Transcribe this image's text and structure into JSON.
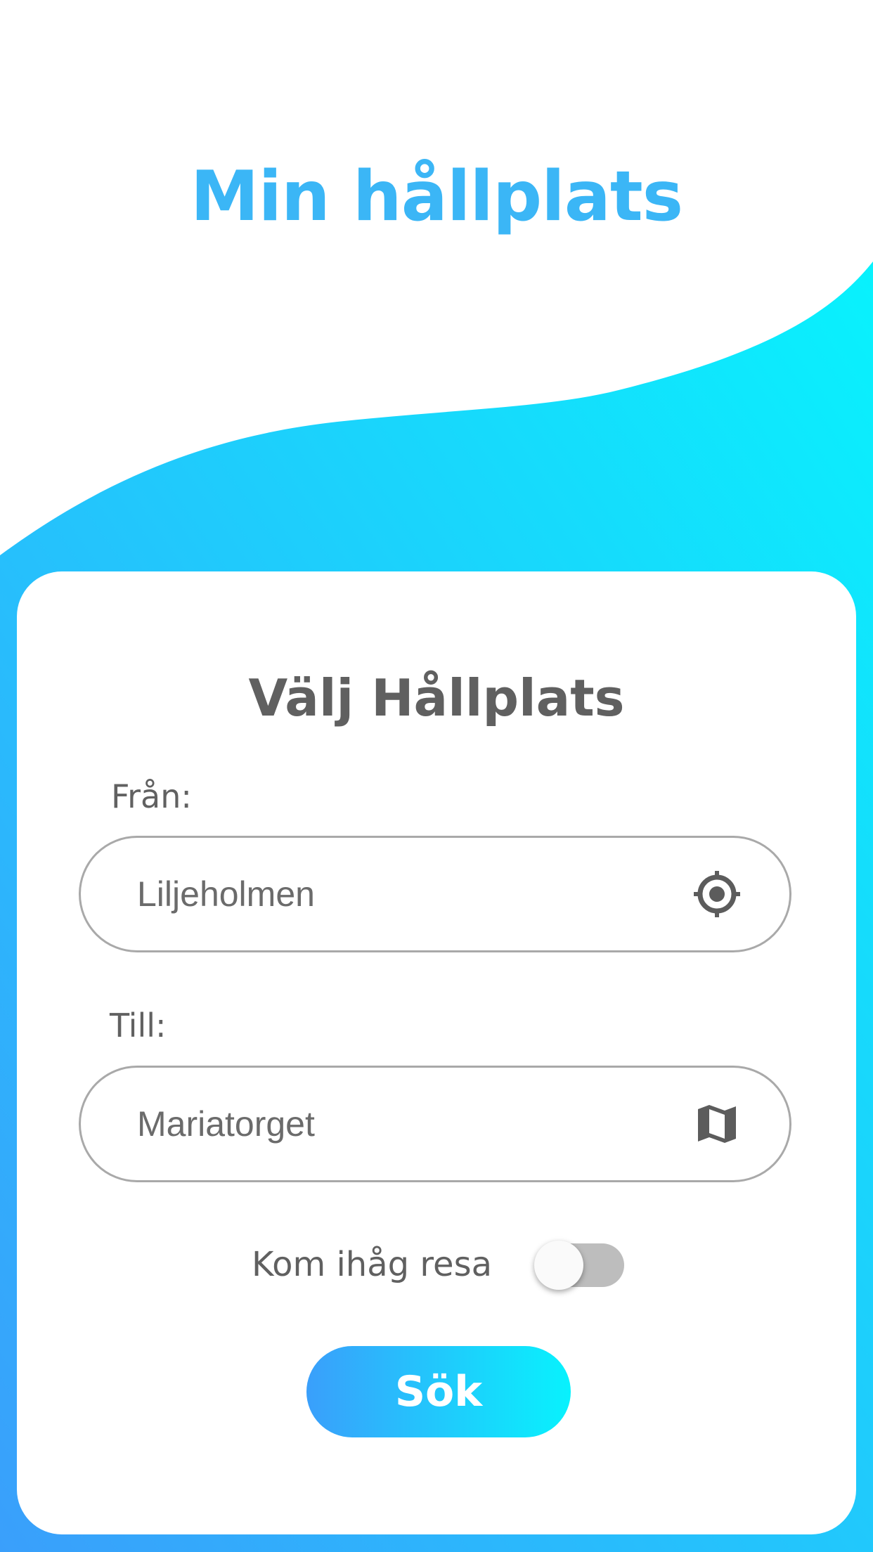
{
  "app_title": "Min hållplats",
  "card": {
    "title": "Välj Hållplats",
    "from": {
      "label": "Från:",
      "value": "Liljeholmen",
      "icon": "gps-crosshair-icon"
    },
    "to": {
      "label": "Till:",
      "value": "Mariatorget",
      "icon": "map-icon"
    },
    "remember": {
      "label": "Kom ihåg resa",
      "enabled": false
    },
    "search_button_label": "Sök"
  },
  "colors": {
    "title_blue": "#3bb6f6",
    "gradient_start": "#3a9ffb",
    "gradient_end": "#08f2fd",
    "text_gray": "#606060",
    "border_gray": "#a9a9a9",
    "toggle_track_off": "#bdbdbd"
  }
}
